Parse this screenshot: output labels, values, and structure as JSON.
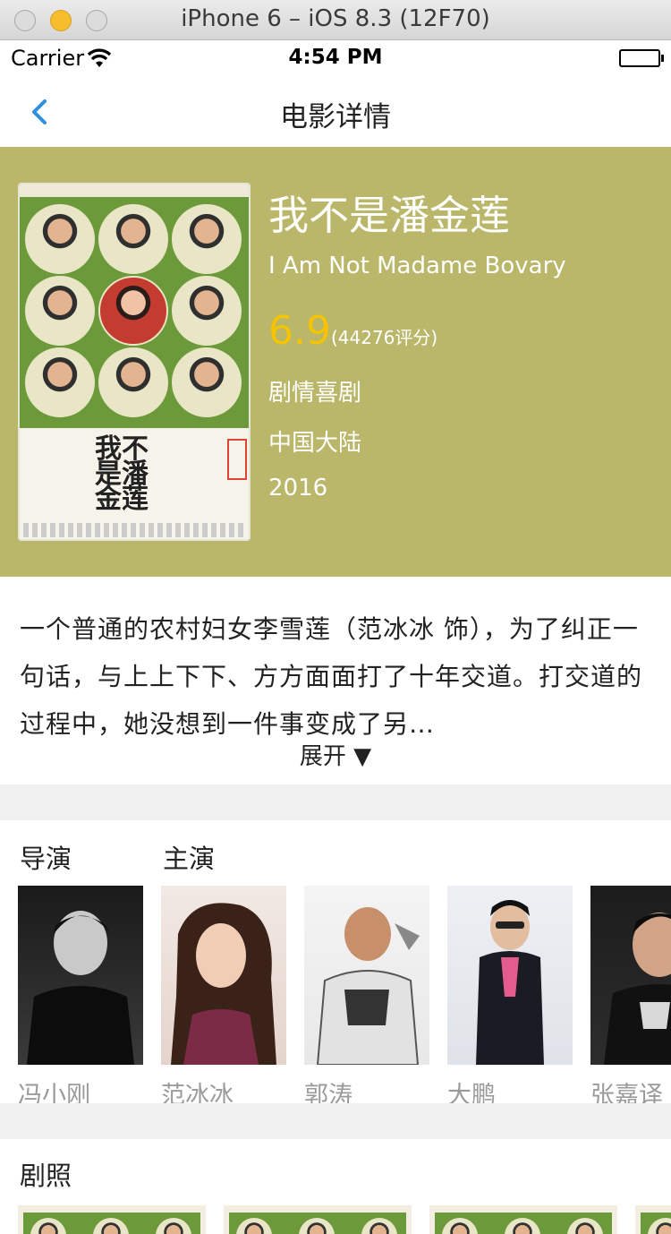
{
  "window": {
    "title": "iPhone 6 – iOS 8.3 (12F70)"
  },
  "status_bar": {
    "carrier": "Carrier",
    "time": "4:54 PM"
  },
  "nav": {
    "title": "电影详情"
  },
  "movie": {
    "title": "我不是潘金莲",
    "title_en": "I Am Not Madame Bovary",
    "score": "6.9",
    "rating_count": "(44276评分)",
    "genre": "剧情喜剧",
    "region": "中国大陆",
    "year": "2016",
    "poster_title": "我不是潘金莲"
  },
  "synopsis": {
    "text": "一个普通的农村妇女李雪莲（范冰冰 饰），为了纠正一句话，与上上下下、方方面面打了十年交道。打交道的过程中，她没想到一件事变成了另…",
    "expand_label": "展开 ▼"
  },
  "cast": {
    "director_label": "导演",
    "actors_label": "主演",
    "people": [
      {
        "name": "冯小刚"
      },
      {
        "name": "范冰冰"
      },
      {
        "name": "郭涛"
      },
      {
        "name": "大鹏"
      },
      {
        "name": "张嘉译"
      }
    ]
  },
  "stills": {
    "label": "剧照"
  },
  "colors": {
    "header_bg": "#bab76a",
    "score": "#f5c300",
    "accent": "#2f8fe0"
  }
}
